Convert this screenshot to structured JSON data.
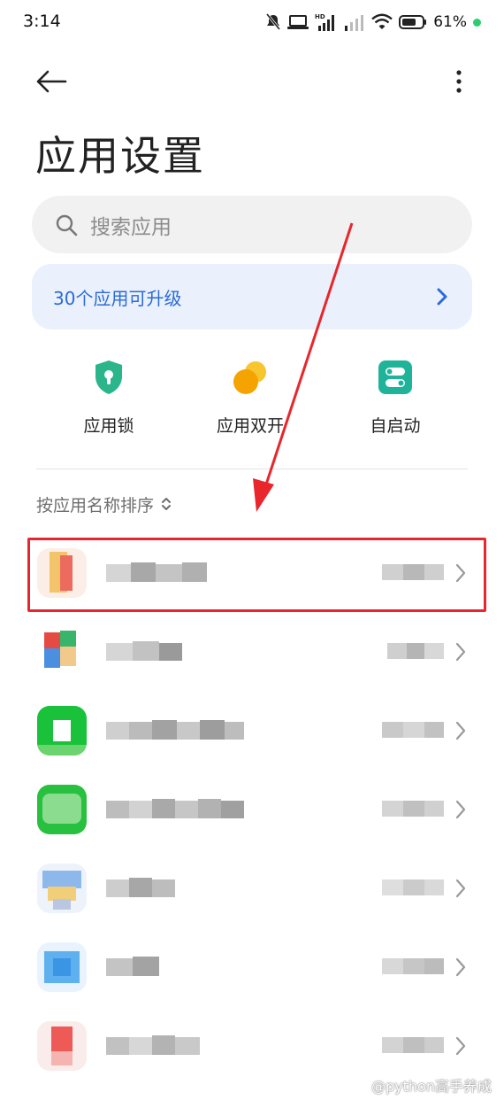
{
  "status_bar": {
    "time": "3:14",
    "battery_text": "61%",
    "icons": [
      "mute-icon",
      "laptop-icon",
      "hd-signal-icon",
      "signal-icon",
      "wifi-icon",
      "battery-icon",
      "charging-dot"
    ]
  },
  "header": {
    "back_icon": "arrow-left-icon",
    "more_icon": "more-vertical-icon",
    "title": "应用设置"
  },
  "search": {
    "placeholder": "搜索应用"
  },
  "upgrade_banner": {
    "text": "30个应用可升级",
    "icon": "chevron-right-icon"
  },
  "quick_actions": [
    {
      "label": "应用锁",
      "icon": "shield-lock-icon"
    },
    {
      "label": "应用双开",
      "icon": "dual-app-icon"
    },
    {
      "label": "自启动",
      "icon": "autostart-toggle-icon"
    }
  ],
  "sort": {
    "label": "按应用名称排序",
    "icon": "sort-updown-icon"
  },
  "app_list": {
    "note": "app names and sizes are pixelated/blurred in the screenshot",
    "rows": 7
  },
  "watermark": {
    "text": "@python高手养成"
  },
  "colors": {
    "accent_blue": "#2b6ad8",
    "banner_bg": "#eaf1fd",
    "search_bg": "#f1f1f1",
    "shield_green": "#2bb58a",
    "dual_orange": "#f5a300",
    "toggle_teal": "#1fb49a",
    "annotation_red": "#e8262c"
  }
}
